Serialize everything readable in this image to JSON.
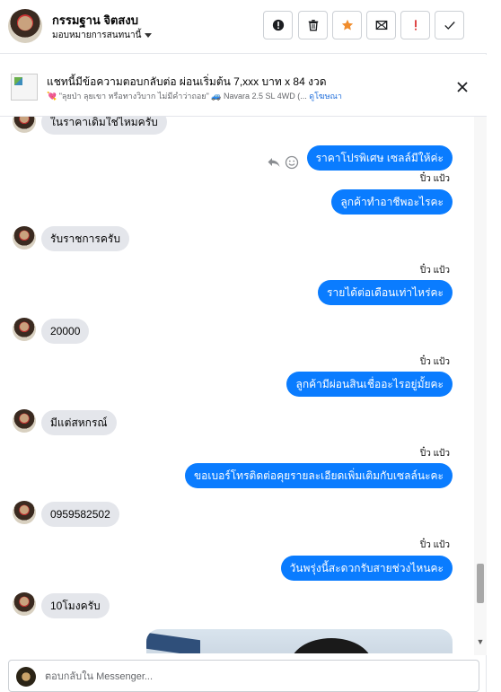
{
  "header": {
    "contact_name": "กรรมฐาน จิตสงบ",
    "assignee_label": "มอบหมายการสนทนานี้",
    "actions": [
      {
        "name": "report-icon",
        "label": "!"
      },
      {
        "name": "trash-icon",
        "label": ""
      },
      {
        "name": "star-icon",
        "label": ""
      },
      {
        "name": "mail-icon",
        "label": ""
      },
      {
        "name": "spam-icon",
        "label": "!"
      },
      {
        "name": "check-icon",
        "label": ""
      }
    ]
  },
  "ad": {
    "title": "แชทนี้มีข้อความตอบกลับต่อ ผ่อนเริ่มต้น 7,xxx บาท x 84 งวด",
    "heart": "💘",
    "subtitle": "\"ลุยป่า ลุยเขา หรือทางวิบาก ไม่มีคำว่าถอย\"",
    "car": "🚙",
    "product": "Navara 2.5 SL 4WD (...",
    "link": "ดูโฆษณา"
  },
  "messages": {
    "m1": "ในราคาเดิมใช่ไหมครับ",
    "m2": "ราคาโปรพิเศษ เซลล์มีให้ค่ะ",
    "s3": "ปิ๋ว แป้ว",
    "m3": "ลูกค้าทำอาชีพอะไรคะ",
    "m4": "รับราชการครับ",
    "s5": "ปิ๋ว แป้ว",
    "m5": "รายได้ต่อเดือนเท่าไหร่คะ",
    "m6": "20000",
    "s7": "ปิ๋ว แป้ว",
    "m7": "ลูกค้ามีผ่อนสินเชื่ออะไรอยู่มั้ยคะ",
    "m8": "มีแต่สหกรณ์",
    "s9": "ปิ๋ว แป้ว",
    "m9": "ขอเบอร์โทรติดต่อคุยรายละเอียดเพิ่มเติมกับเซลล์นะคะ",
    "m10": "0959582502",
    "s11": "ปิ๋ว แป้ว",
    "m11": "วันพรุ่งนี้สะดวกรับสายช่วงไหนคะ",
    "m12": "10โมงครับ"
  },
  "composer": {
    "placeholder": "ตอบกลับใน Messenger..."
  },
  "colors": {
    "outgoing_bubble": "#0a7cff",
    "incoming_bubble": "#e4e6eb",
    "star": "#f08c2c",
    "danger": "#d92c2c"
  }
}
